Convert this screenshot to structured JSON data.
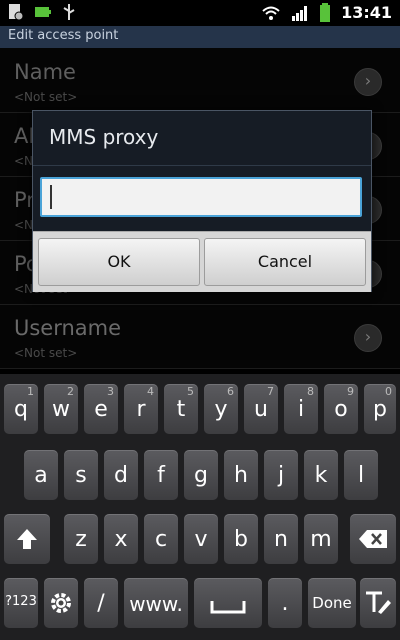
{
  "status_bar": {
    "time": "13:41",
    "icons_left": [
      "settings-doc-icon",
      "battery-full-icon",
      "usb-icon"
    ],
    "icons_right": [
      "wifi-icon",
      "signal-icon",
      "battery-icon"
    ]
  },
  "title_bar": {
    "title": "Edit access point"
  },
  "list": {
    "items": [
      {
        "label": "Name",
        "value": "<Not set>"
      },
      {
        "label": "APN",
        "value": "<Not set>"
      },
      {
        "label": "Proxy",
        "value": "<Not set>"
      },
      {
        "label": "Port",
        "value": "<Not set>"
      },
      {
        "label": "Username",
        "value": "<Not set>"
      }
    ]
  },
  "dialog": {
    "title": "MMS proxy",
    "input_value": "",
    "ok_label": "OK",
    "cancel_label": "Cancel"
  },
  "keyboard": {
    "row1": [
      {
        "key": "q",
        "hint": "1"
      },
      {
        "key": "w",
        "hint": "2"
      },
      {
        "key": "e",
        "hint": "3"
      },
      {
        "key": "r",
        "hint": "4"
      },
      {
        "key": "t",
        "hint": "5"
      },
      {
        "key": "y",
        "hint": "6"
      },
      {
        "key": "u",
        "hint": "7"
      },
      {
        "key": "i",
        "hint": "8"
      },
      {
        "key": "o",
        "hint": "9"
      },
      {
        "key": "p",
        "hint": "0"
      }
    ],
    "row2": [
      "a",
      "s",
      "d",
      "f",
      "g",
      "h",
      "j",
      "k",
      "l"
    ],
    "row3": [
      "z",
      "x",
      "c",
      "v",
      "b",
      "n",
      "m"
    ],
    "row4": {
      "sym_label": "?123",
      "slash_label": "/",
      "www_label": "www.",
      "dot_label": ".",
      "done_label": "Done"
    }
  }
}
